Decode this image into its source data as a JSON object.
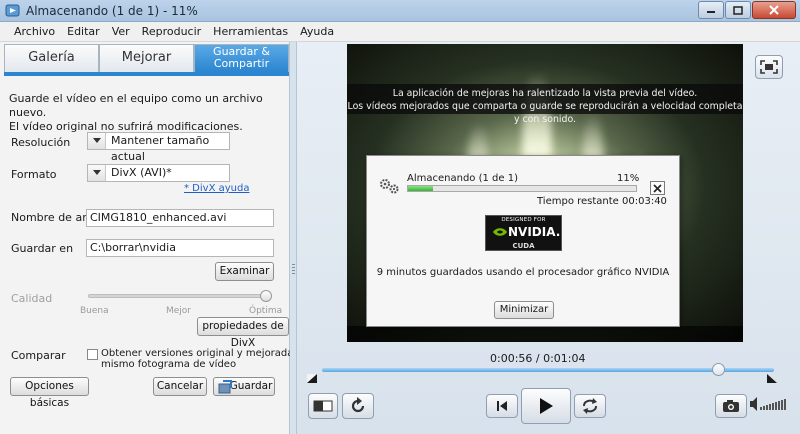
{
  "window": {
    "title": "Almacenando (1 de 1) - 11%"
  },
  "menu": [
    "Archivo",
    "Editar",
    "Ver",
    "Reproducir",
    "Herramientas",
    "Ayuda"
  ],
  "tabs": [
    {
      "label": "Galería"
    },
    {
      "label": "Mejorar"
    },
    {
      "label": "Guardar & Compartir",
      "line1": "Guardar &",
      "line2": "Compartir",
      "active": true
    }
  ],
  "save_panel": {
    "description_line1": "Guarde el vídeo en el equipo como un archivo nuevo.",
    "description_line2": "El vídeo original no sufrirá modificaciones.",
    "resolution_label": "Resolución",
    "resolution_value": "Mantener tamaño actual",
    "format_label": "Formato",
    "format_value": "DivX (AVI)*",
    "divx_help_link": "* DivX ayuda",
    "filename_label": "Nombre de archivo",
    "filename_value": "CIMG1810_enhanced.avi",
    "save_in_label": "Guardar en",
    "save_in_value": "C:\\borrar\\nvidia",
    "browse_button": "Examinar",
    "quality_label": "Calidad",
    "quality_marks": [
      "Buena",
      "Mejor",
      "Óptima"
    ],
    "quality_level": 1.0,
    "divx_properties_button": "propiedades de DivX",
    "compare_label": "Comparar",
    "compare_checkbox_line1": "Obtener versiones original y mejorada en el",
    "compare_checkbox_line2": "mismo fotograma de vídeo",
    "compare_checked": false,
    "basic_options_button": "Opciones básicas",
    "cancel_button": "Cancelar",
    "save_button": "Guardar"
  },
  "preview": {
    "notice_line1": "La aplicación de mejoras ha ralentizado la vista previa del vídeo.",
    "notice_line2": "Los vídeos mejorados que comparta o guarde se reproducirán a velocidad completa y con sonido."
  },
  "progress_dialog": {
    "title": "Almacenando (1 de 1)",
    "percent_text": "11%",
    "progress": 0.11,
    "time_remaining": "Tiempo restante 00:03:40",
    "badge_top": "DESIGNED FOR",
    "badge_brand": "NVIDIA.",
    "badge_bottom": "CUDA",
    "message": "9 minutos guardados usando el procesador gráfico NVIDIA",
    "minimize_button": "Minimizar"
  },
  "player": {
    "timecode": "0:00:56 / 0:01:04",
    "position": 0.875
  }
}
